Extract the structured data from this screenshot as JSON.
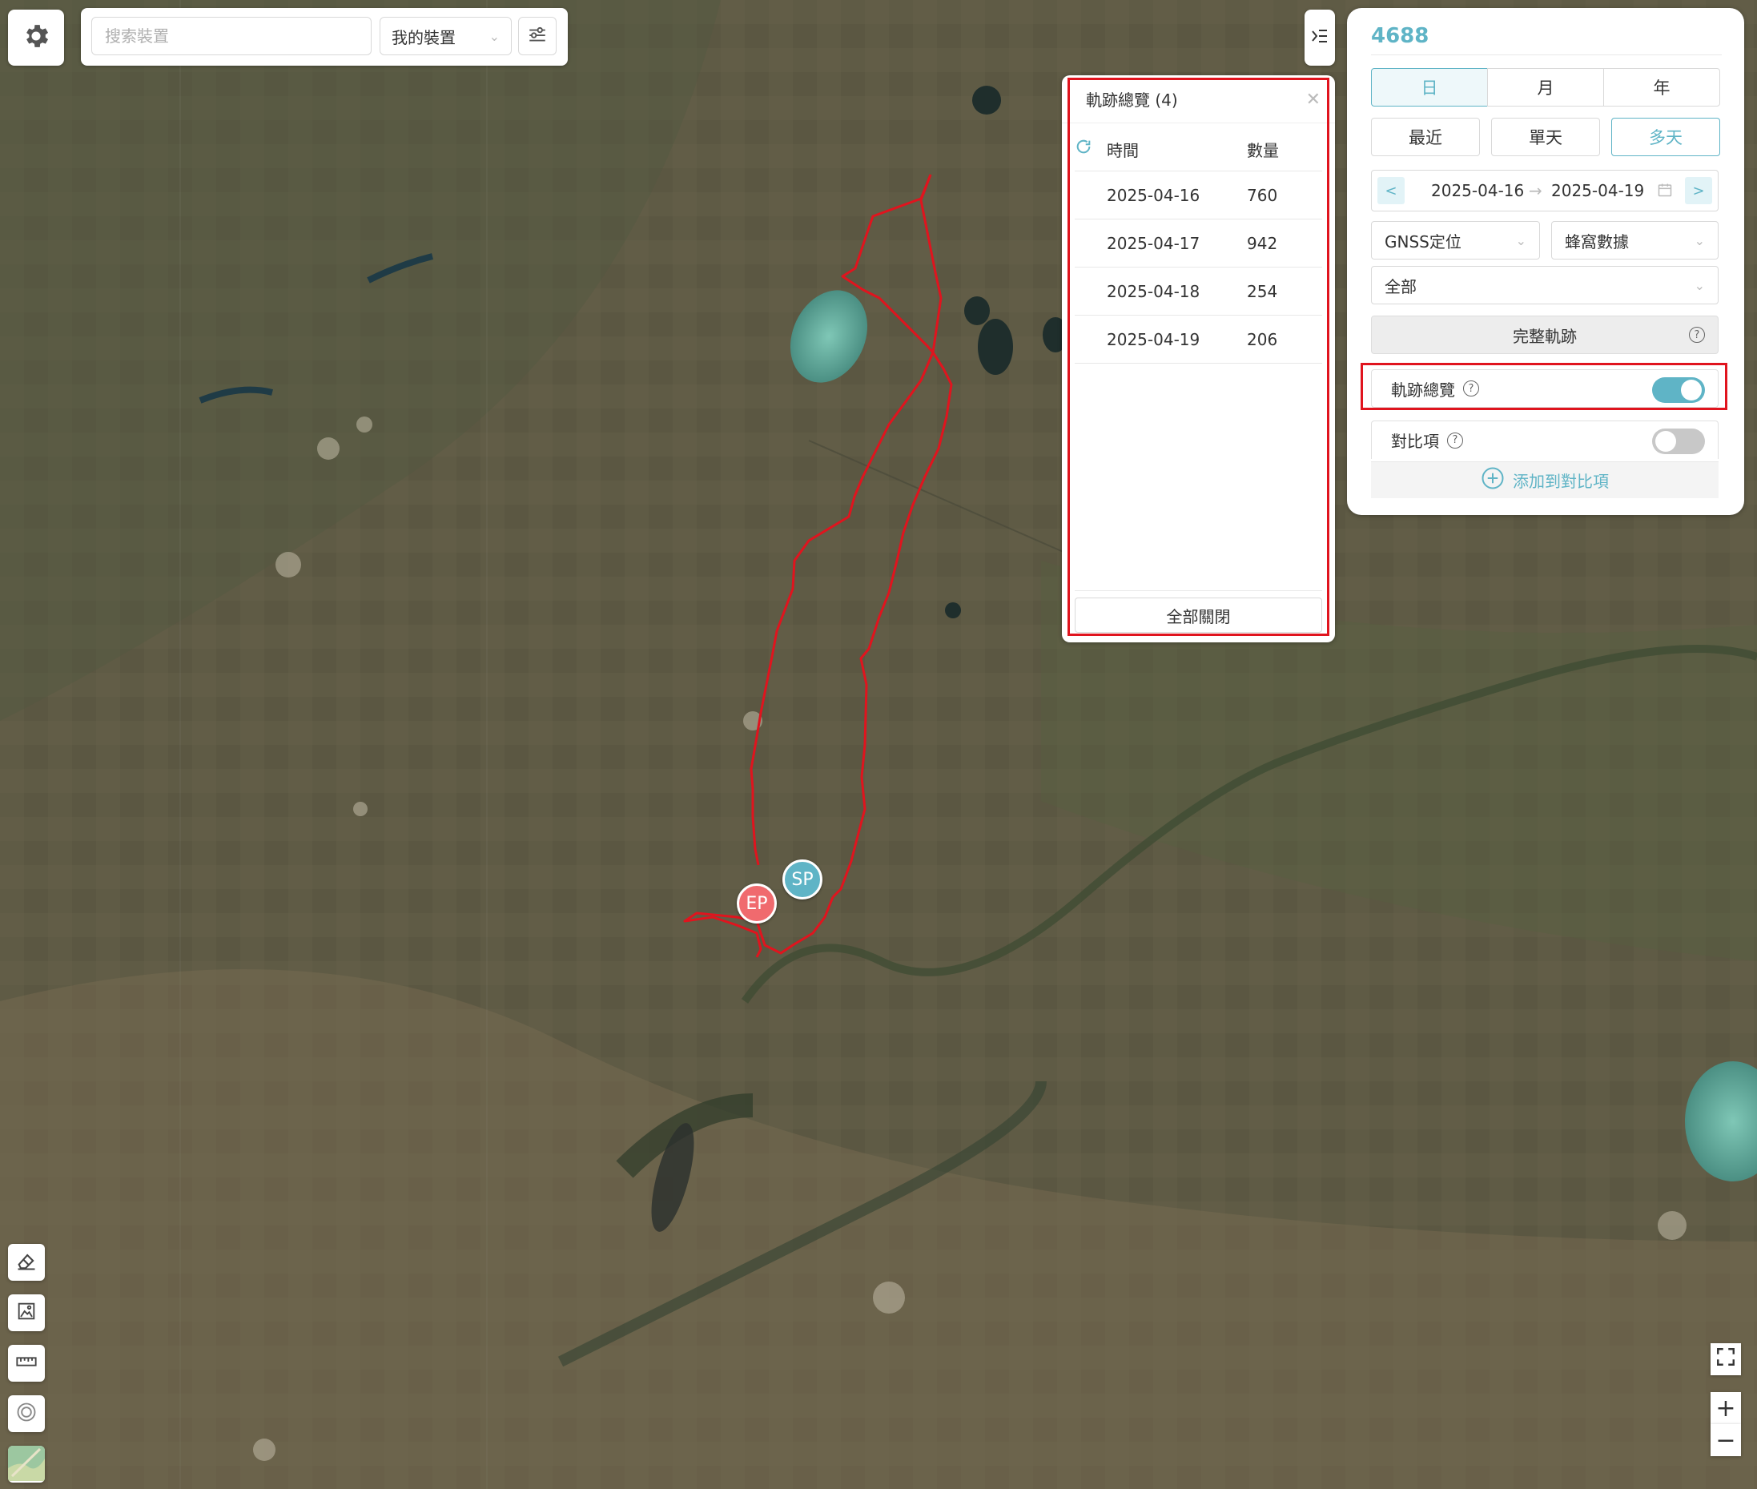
{
  "toolbar": {
    "search_placeholder": "搜索裝置",
    "device_select": "我的裝置"
  },
  "overview": {
    "title": "軌跡總覽 (4)",
    "col_time": "時間",
    "col_count": "數量",
    "rows": [
      {
        "date": "2025-04-16",
        "count": "760"
      },
      {
        "date": "2025-04-17",
        "count": "942"
      },
      {
        "date": "2025-04-18",
        "count": "254"
      },
      {
        "date": "2025-04-19",
        "count": "206"
      }
    ],
    "close_all": "全部關閉"
  },
  "panel": {
    "device_id": "4688",
    "period_tabs": [
      "日",
      "月",
      "年"
    ],
    "range_tabs": [
      "最近",
      "單天",
      "多天"
    ],
    "prev": "<",
    "next": ">",
    "start_date": "2025-04-16",
    "end_date": "2025-04-19",
    "range_arrow": "→",
    "source": "GNSS定位",
    "cell_data": "蜂窩數據",
    "filter": "全部",
    "full_track": "完整軌跡",
    "track_overview": "軌跡總覽",
    "track_overview_on": true,
    "compare": "對比項",
    "compare_on": false,
    "add_compare": "添加到對比項"
  },
  "markers": {
    "start": "SP",
    "end": "EP"
  },
  "colors": {
    "accent": "#5fb4c6",
    "track": "#e0141e",
    "highlight": "#e0141e"
  },
  "icons": {
    "settings": "gear-icon",
    "filter": "filter-icon",
    "collapse": "collapse-icon",
    "calendar": "calendar-icon",
    "eraser": "eraser-icon",
    "image": "image-icon",
    "ruler": "ruler-icon",
    "target": "target-icon",
    "layer": "map-layer-icon",
    "fullscreen": "fullscreen-icon",
    "zoom_in": "zoom-in-icon",
    "zoom_out": "zoom-out-icon"
  },
  "map_controls": {
    "zoom_in": "+",
    "zoom_out": "−"
  }
}
